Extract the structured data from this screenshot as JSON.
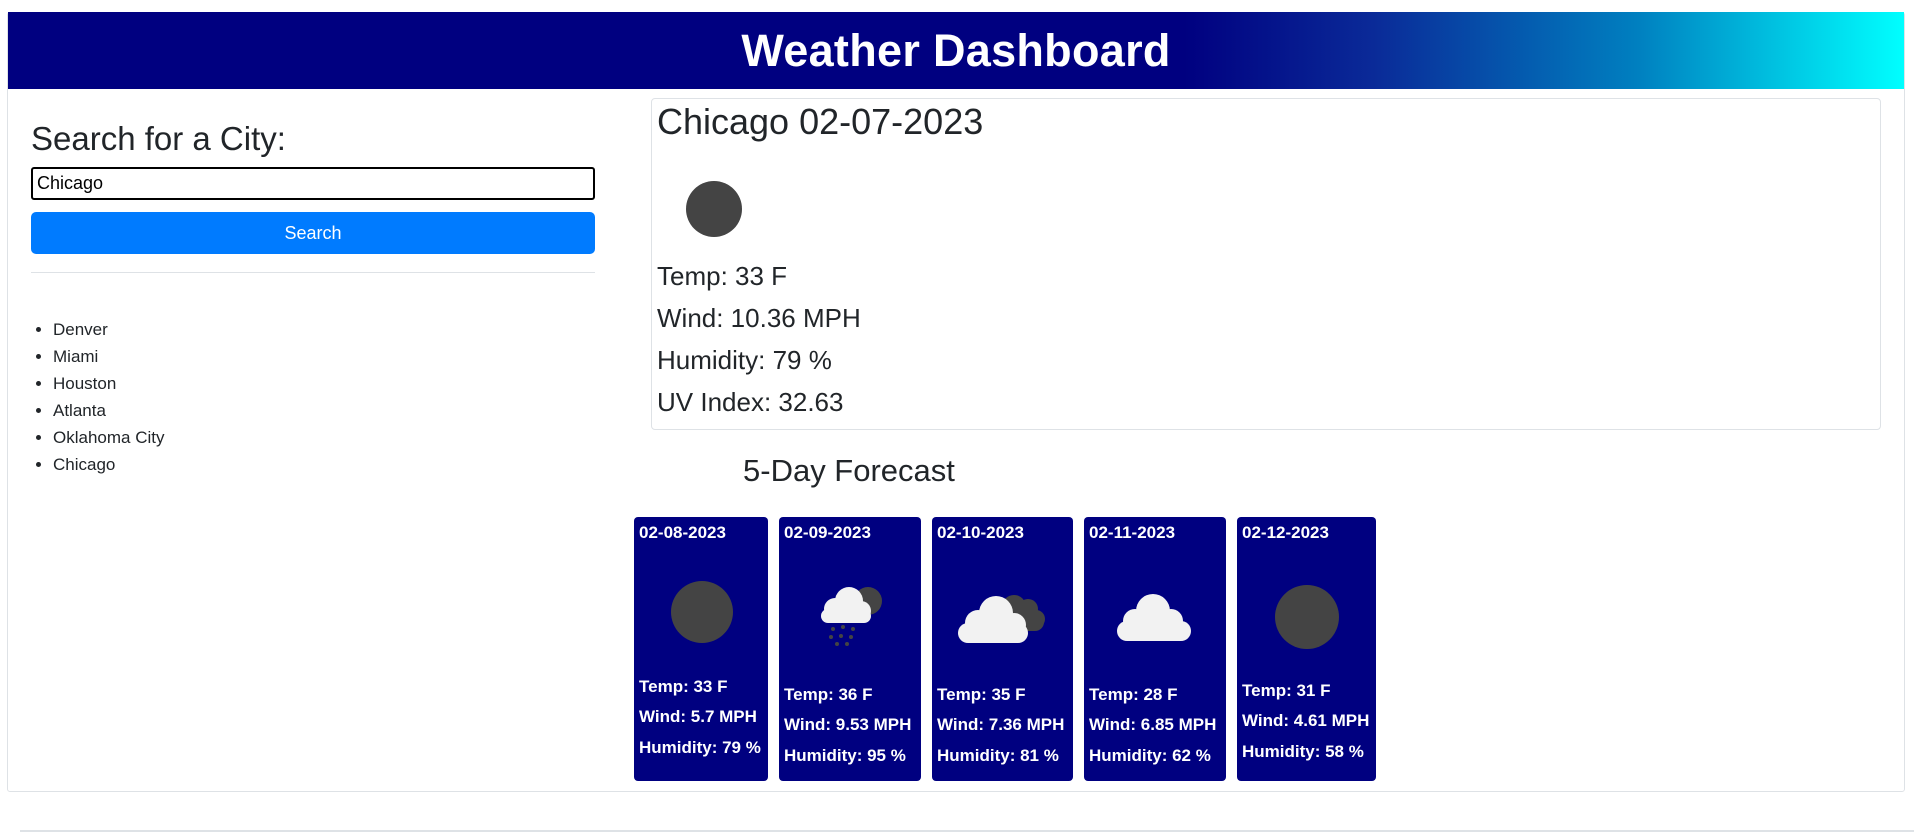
{
  "header": {
    "title": "Weather Dashboard"
  },
  "search": {
    "title": "Search for a City:",
    "input_value": "Chicago",
    "button_label": "Search"
  },
  "history": [
    "Denver",
    "Miami",
    "Houston",
    "Atlanta",
    "Oklahoma City",
    "Chicago"
  ],
  "current": {
    "title": "Chicago 02-07-2023",
    "icon": "clear-night-icon",
    "temp": "Temp: 33 F",
    "wind": "Wind: 10.36 MPH",
    "humidity": "Humidity: 79 %",
    "uv": "UV Index: 32.63"
  },
  "forecast": {
    "title": "5-Day Forecast",
    "days": [
      {
        "date": "02-08-2023",
        "icon": "clear-night-icon",
        "temp": "Temp: 33 F",
        "wind": "Wind: 5.7 MPH",
        "humidity": "Humidity: 79 %"
      },
      {
        "date": "02-09-2023",
        "icon": "rain-cloud-icon",
        "temp": "Temp: 36 F",
        "wind": "Wind: 9.53 MPH",
        "humidity": "Humidity: 95 %"
      },
      {
        "date": "02-10-2023",
        "icon": "broken-clouds-icon",
        "temp": "Temp: 35 F",
        "wind": "Wind: 7.36 MPH",
        "humidity": "Humidity: 81 %"
      },
      {
        "date": "02-11-2023",
        "icon": "cloud-icon",
        "temp": "Temp: 28 F",
        "wind": "Wind: 6.85 MPH",
        "humidity": "Humidity: 62 %"
      },
      {
        "date": "02-12-2023",
        "icon": "clear-night-icon",
        "temp": "Temp: 31 F",
        "wind": "Wind: 4.61 MPH",
        "humidity": "Humidity: 58 %"
      }
    ]
  },
  "colors": {
    "header_start": "#000080",
    "header_end": "#00ffff",
    "search_button": "#007bff",
    "forecast_card": "#000080",
    "moon_icon": "#444444"
  }
}
